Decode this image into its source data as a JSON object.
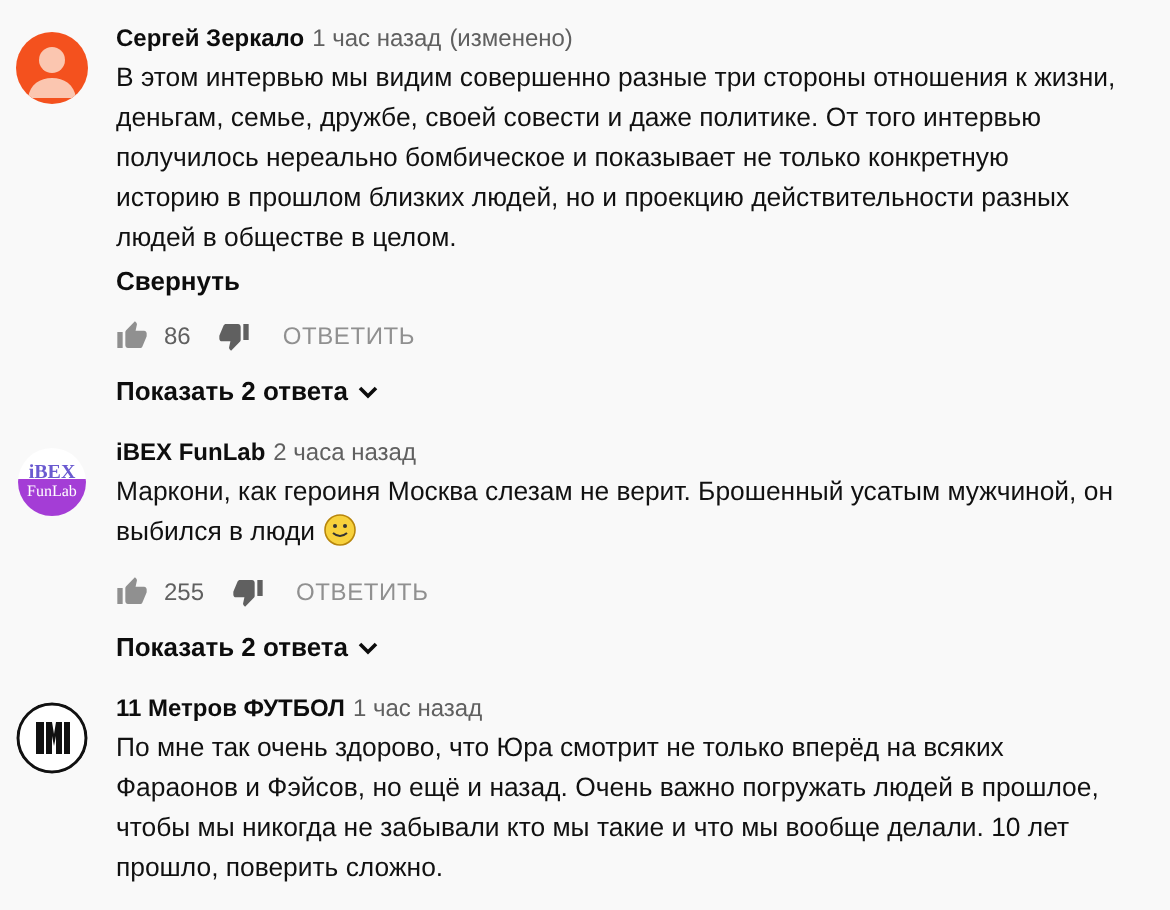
{
  "comments": [
    {
      "avatar": {
        "kind": "person",
        "color": "#f4511e"
      },
      "author": "Сергей Зеркало",
      "time": "1 час назад",
      "edited": "(изменено)",
      "text": "В этом интервью мы видим совершенно разные три стороны отношения к жизни, деньгам, семье, дружбе, своей совести и даже политике. От того интервью получилось нереально бомбическое и показывает не только конкретную историю в прошлом близких людей, но и проекцию действительности разных людей  в обществе в целом.",
      "collapse": "Свернуть",
      "likes": "86",
      "reply": "ОТВЕТИТЬ",
      "replies": "Показать 2 ответа"
    },
    {
      "avatar": {
        "kind": "logo",
        "lines": [
          "iBEX",
          "FunLab"
        ]
      },
      "author": "iBEX FunLab",
      "time": "2 часа назад",
      "text": "Маркони, как героиня Москва слезам не верит. Брошенный усатым мужчиной, он выбился в люди",
      "emoji": true,
      "likes": "255",
      "reply": "ОТВЕТИТЬ",
      "replies": "Показать 2 ответа"
    },
    {
      "avatar": {
        "kind": "emblem"
      },
      "author": "11 Метров ФУТБОЛ",
      "time": "1 час назад",
      "text": "По мне так очень здорово, что Юра смотрит не только вперёд на всяких Фараонов и Фэйсов, но ещё и назад. Очень важно погружать людей в прошлое, чтобы мы никогда не забывали кто мы такие и что мы вообще делали. 10 лет прошло, поверить сложно."
    }
  ]
}
